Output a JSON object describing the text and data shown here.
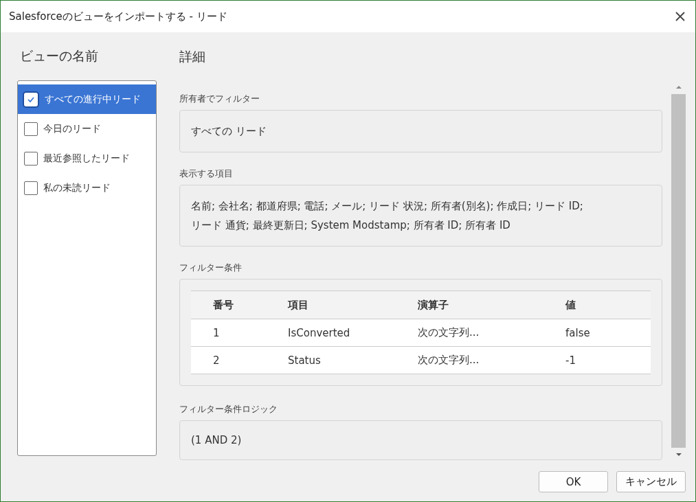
{
  "window": {
    "title": "Salesforceのビューをインポートする - リード"
  },
  "views": {
    "heading": "ビューの名前",
    "items": [
      {
        "label": "すべての進行中リード",
        "selected": true,
        "checked": true
      },
      {
        "label": "今日のリード",
        "selected": false,
        "checked": false
      },
      {
        "label": "最近参照したリード",
        "selected": false,
        "checked": false
      },
      {
        "label": "私の未読リード",
        "selected": false,
        "checked": false
      }
    ]
  },
  "details": {
    "heading": "詳細",
    "owner_filter": {
      "label": "所有者でフィルター",
      "value": "すべての リード"
    },
    "fields": {
      "label": "表示する項目",
      "value": "名前; 会社名; 都道府県; 電話; メール; リード 状況; 所有者(別名); 作成日; リード ID; リード 通貨; 最終更新日; System Modstamp; 所有者 ID; 所有者 ID"
    },
    "filter_conditions": {
      "label": "フィルター条件",
      "columns": [
        "番号",
        "項目",
        "演算子",
        "値"
      ],
      "rows": [
        [
          "1",
          "IsConverted",
          "次の文字列...",
          "false"
        ],
        [
          "2",
          "Status",
          "次の文字列...",
          "-1"
        ]
      ]
    },
    "filter_logic": {
      "label": "フィルター条件ロジック",
      "value": "(1 AND 2)"
    }
  },
  "buttons": [
    "OK",
    "キャンセル"
  ]
}
